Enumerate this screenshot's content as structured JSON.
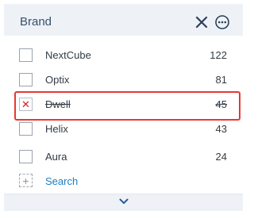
{
  "panel": {
    "title": "Brand",
    "close_icon": "close-icon",
    "more_icon": "more-options-icon"
  },
  "items": [
    {
      "label": "NextCube",
      "count": "122",
      "state": "unchecked"
    },
    {
      "label": "Optix",
      "count": "81",
      "state": "unchecked"
    },
    {
      "label": "Dwell",
      "count": "45",
      "state": "excluded"
    },
    {
      "label": "Helix",
      "count": "43",
      "state": "unchecked"
    },
    {
      "label": "Aura",
      "count": "24",
      "state": "unchecked"
    }
  ],
  "search": {
    "label": "Search",
    "icon": "add-icon"
  },
  "footer": {
    "icon": "chevron-down-icon"
  },
  "colors": {
    "accent": "#1a7fc1",
    "exclude": "#d32020",
    "highlight": "#e53935",
    "header_bg": "#eef2f7"
  }
}
